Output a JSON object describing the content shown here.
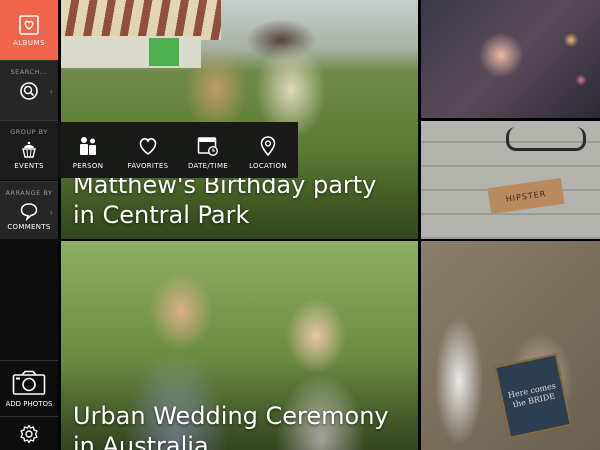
{
  "sidebar": {
    "albums_label": "ALBUMS",
    "search_title": "SEARCH...",
    "group_by_title": "GROUP BY",
    "group_by_current": "EVENTS",
    "arrange_by_title": "ARRANGE BY",
    "arrange_by_current": "COMMENTS",
    "add_photos_label": "ADD PHOTOS"
  },
  "group_by_menu": {
    "items": [
      {
        "label": "PERSON",
        "icon": "person-icon"
      },
      {
        "label": "FAVORITES",
        "icon": "heart-icon"
      },
      {
        "label": "DATE/TIME",
        "icon": "calendar-clock-icon"
      },
      {
        "label": "LOCATION",
        "icon": "location-pin-icon"
      }
    ]
  },
  "albums": [
    {
      "title_line1": "Matthew's Birthday party",
      "title_line2": "in Central Park"
    },
    {
      "title_line1": "Urban Wedding Ceremony",
      "title_line2": "in Australia"
    }
  ],
  "photos": {
    "hipster_tag": "HIPSTER",
    "kids_board_text": "Here comes the BRIDE"
  },
  "colors": {
    "accent": "#f0654d",
    "sidebar_bg": "#0d0d0d",
    "panel_bg": "#262626"
  }
}
